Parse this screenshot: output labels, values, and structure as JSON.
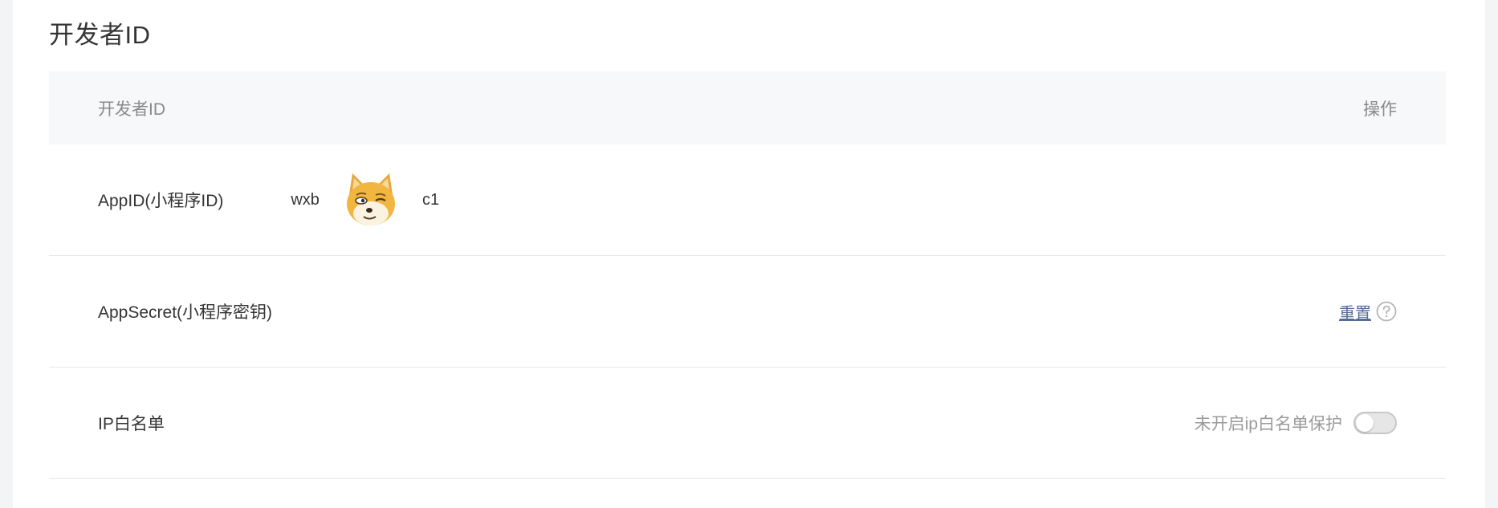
{
  "section": {
    "title": "开发者ID"
  },
  "table": {
    "headers": {
      "id": "开发者ID",
      "action": "操作"
    },
    "rows": [
      {
        "label": "AppID(小程序ID)",
        "value_prefix": "wxb",
        "value_suffix": "c1",
        "value_mask_icon": "doge-face-icon"
      },
      {
        "label": "AppSecret(小程序密钥)",
        "action_label": "重置",
        "help_icon": "question-circle-icon"
      },
      {
        "label": "IP白名单",
        "status": "未开启ip白名单保护",
        "toggle_on": false
      }
    ]
  },
  "colors": {
    "link": "#576b95",
    "header_bg": "#f6f8f9",
    "divider": "#e7e7eb"
  }
}
